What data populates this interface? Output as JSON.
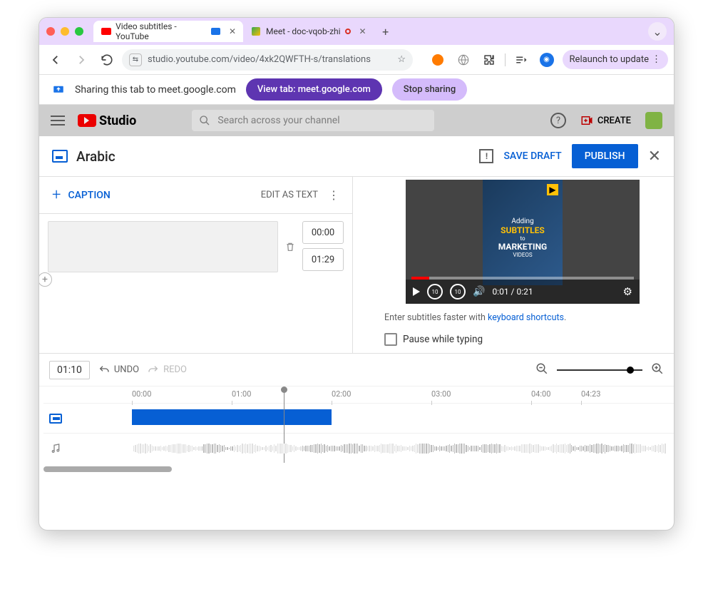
{
  "browser": {
    "tabs": [
      {
        "title": "Video subtitles - YouTube",
        "favicon": "youtube"
      },
      {
        "title": "Meet - doc-vqob-zhi",
        "favicon": "meet"
      }
    ],
    "url": "studio.youtube.com/video/4xk2QWFTH-s/translations",
    "relaunch_label": "Relaunch to update"
  },
  "sharing": {
    "message": "Sharing this tab to meet.google.com",
    "view_tab": "View tab: meet.google.com",
    "stop": "Stop sharing"
  },
  "yt_header": {
    "logo_text": "Studio",
    "search_placeholder": "Search across your channel",
    "create_label": "CREATE"
  },
  "editor": {
    "language": "Arabic",
    "save_draft": "SAVE DRAFT",
    "publish": "PUBLISH",
    "caption_btn": "CAPTION",
    "edit_as_text": "EDIT AS TEXT",
    "caption_row": {
      "start": "00:00",
      "end": "01:29"
    },
    "hint_prefix": "Enter subtitles faster with ",
    "hint_link": "keyboard shortcuts",
    "pause_label": "Pause while typing"
  },
  "video": {
    "timecode": "0:01 / 0:21",
    "thumb": {
      "adding": "Adding",
      "subtitles": "SUBTITLES",
      "to": "to",
      "marketing": "MARKETING",
      "videos": "VIDEOS"
    }
  },
  "timeline": {
    "current": "01:10",
    "undo": "UNDO",
    "redo": "REDO",
    "ticks": [
      "00:00",
      "01:00",
      "02:00",
      "03:00",
      "04:00",
      "04:23"
    ]
  }
}
